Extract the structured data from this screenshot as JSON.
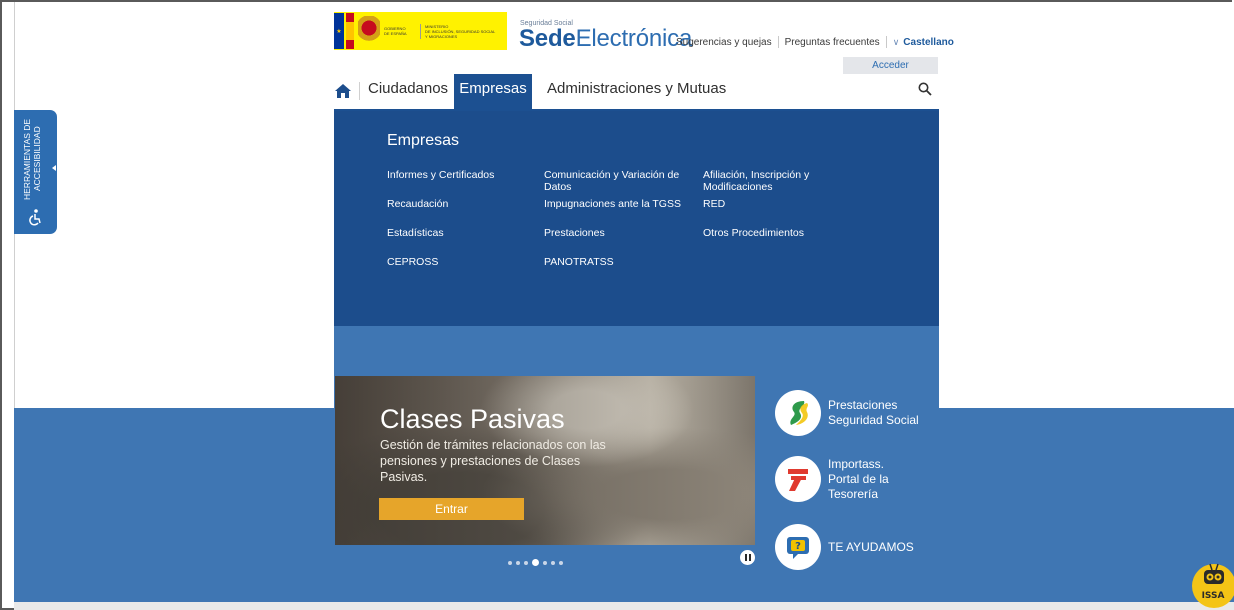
{
  "header": {
    "gov_line1": "GOBIERNO",
    "gov_line2": "DE ESPAÑA",
    "ministry_line1": "MINISTERIO",
    "ministry_line2": "DE INCLUSIÓN, SEGURIDAD SOCIAL",
    "ministry_line3": "Y MIGRACIONES",
    "sede_small": "Seguridad Social",
    "sede_bold": "Sede",
    "sede_rest": "Electrónica",
    "links": [
      "Sugerencias y quejas",
      "Preguntas frecuentes"
    ],
    "language": "Castellano",
    "acceder": "Acceder"
  },
  "nav": {
    "items": [
      "Ciudadanos",
      "Empresas",
      "Administraciones y Mutuas"
    ],
    "active": "Empresas"
  },
  "dropdown": {
    "title": "Empresas",
    "col1": [
      "Informes y Certificados",
      "Recaudación",
      "Estadísticas",
      "CEPROSS"
    ],
    "col2": [
      "Comunicación y Variación de Datos",
      "Impugnaciones ante la TGSS",
      "Prestaciones",
      "PANOTRATSS"
    ],
    "col3": [
      "Afiliación, Inscripción y Modificaciones",
      "RED",
      "Otros Procedimientos"
    ]
  },
  "slider": {
    "title": "Clases Pasivas",
    "text": "Gestión de trámites relacionados con las pensiones y prestaciones de Clases Pasivas.",
    "button": "Entrar",
    "dot_count": 7,
    "active_dot": 4
  },
  "side_links": [
    {
      "label_line1": "Prestaciones",
      "label_line2": "Seguridad Social",
      "label_line3": "",
      "icon": "seguridad-social-logo"
    },
    {
      "label_line1": "Importass.",
      "label_line2": "Portal de la",
      "label_line3": "Tesorería",
      "icon": "importass-logo"
    },
    {
      "label_line1": "TE AYUDAMOS",
      "label_line2": "",
      "label_line3": "",
      "icon": "help-question-icon"
    }
  ],
  "accessibility": {
    "line1": "HERRAMIENTAS DE",
    "line2": "ACCESIBILIDAD"
  },
  "chatbot": {
    "label": "ISSA"
  },
  "colors": {
    "primary_dark": "#1c4d8c",
    "primary": "#2d6db1",
    "band": "#3f76b3",
    "button": "#e6a52a"
  }
}
